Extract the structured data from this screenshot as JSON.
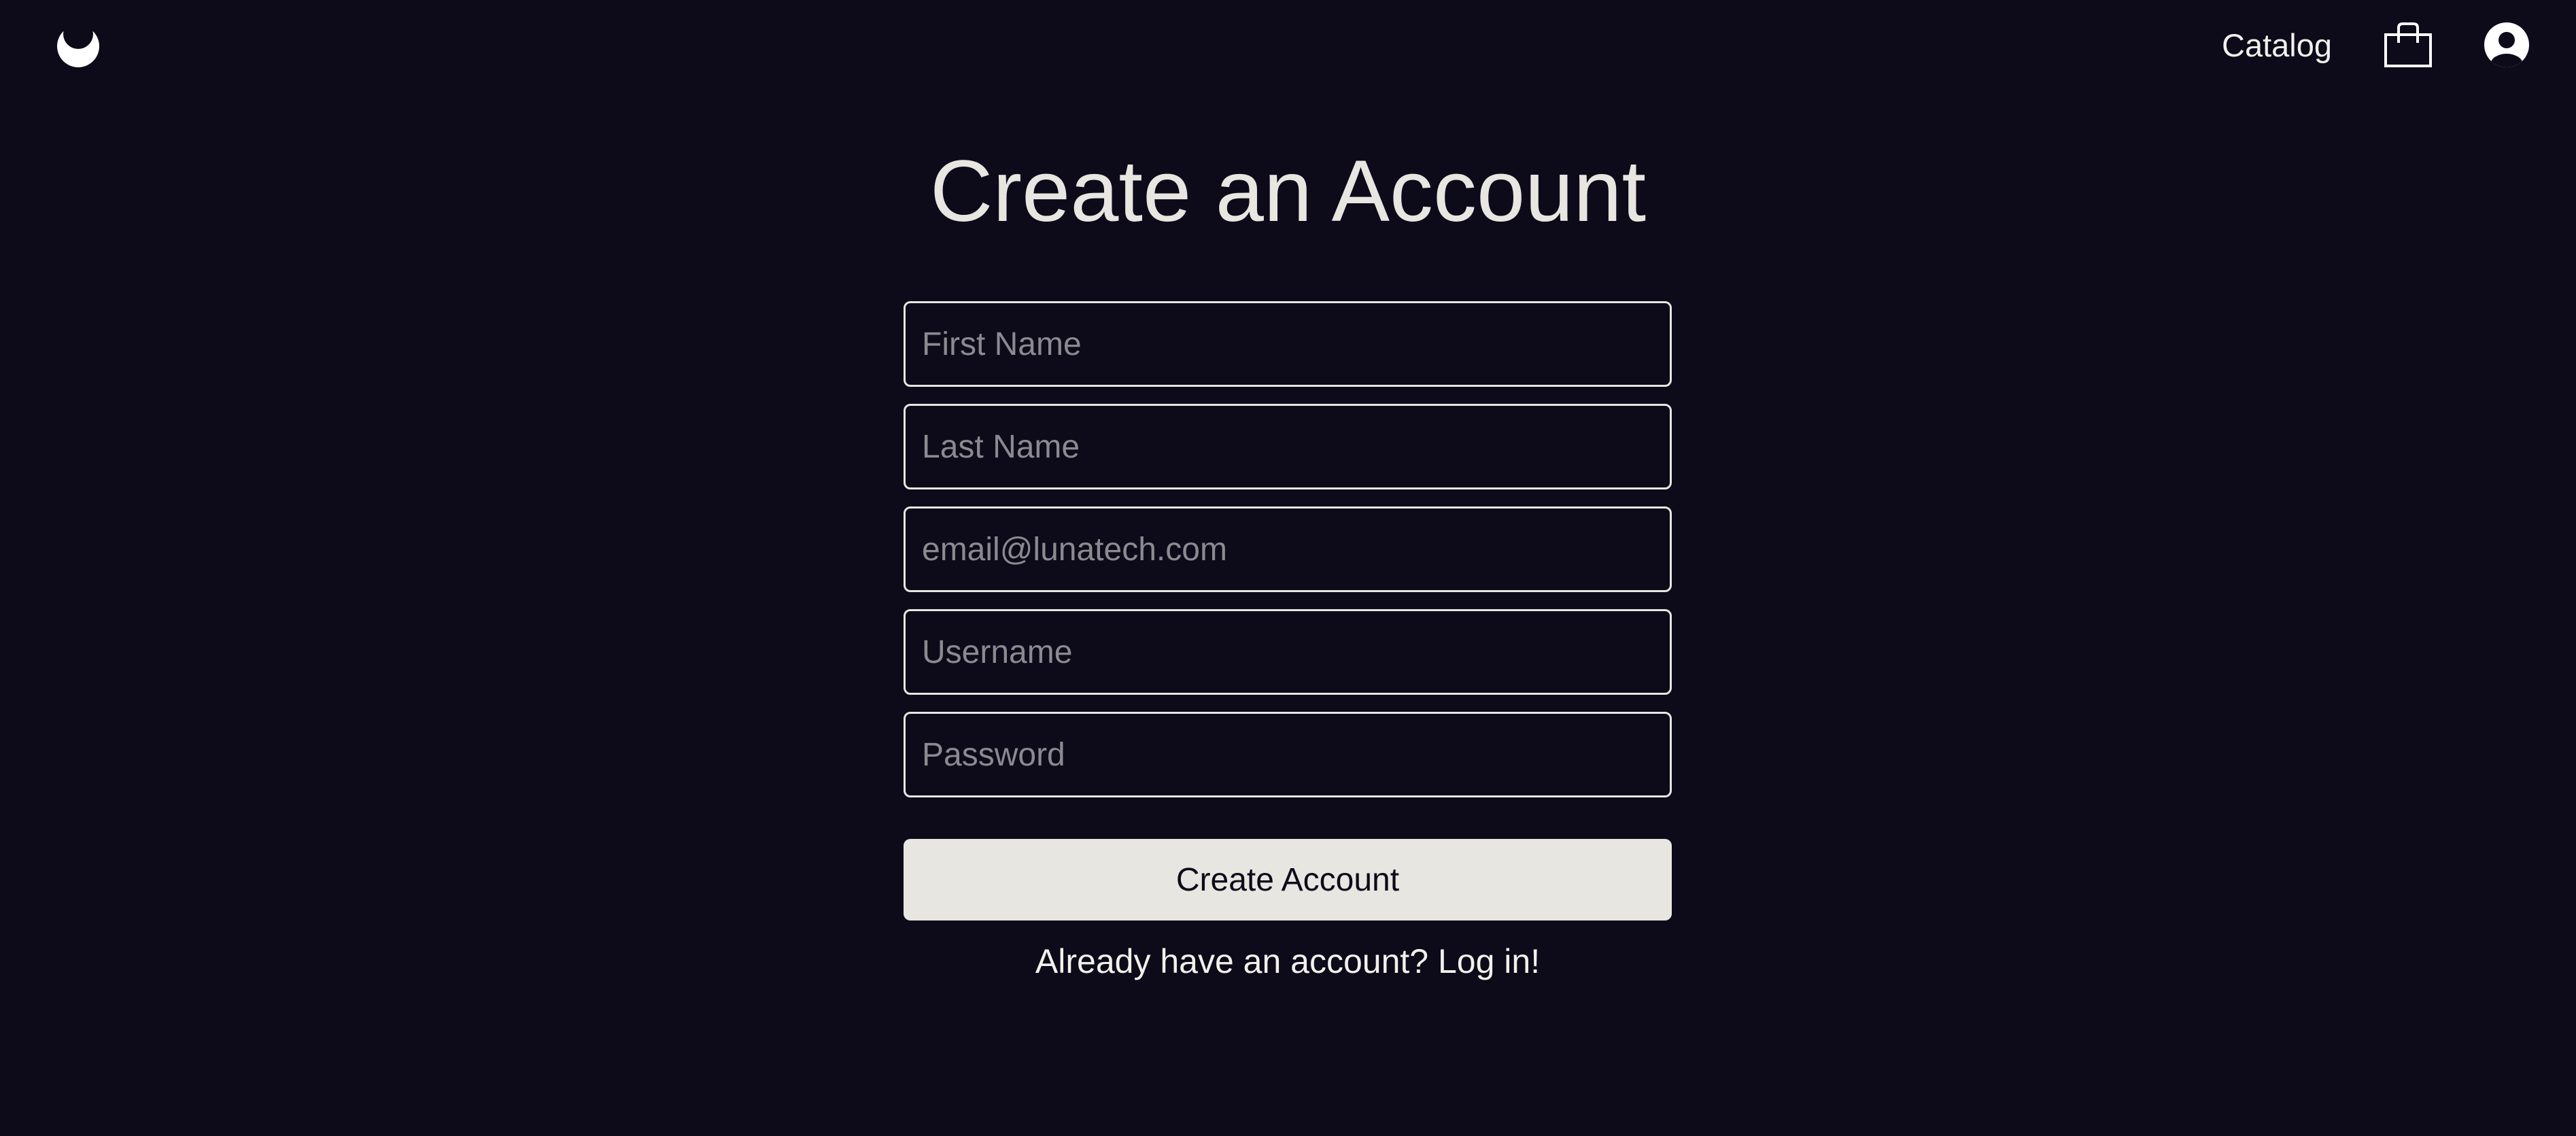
{
  "header": {
    "logo_icon": "crescent-moon-icon",
    "nav_catalog_label": "Catalog",
    "cart_icon": "shopping-bag-icon",
    "account_icon": "user-avatar-icon"
  },
  "main": {
    "title": "Create an Account",
    "fields": {
      "first_name": {
        "placeholder": "First Name",
        "value": ""
      },
      "last_name": {
        "placeholder": "Last Name",
        "value": ""
      },
      "email": {
        "placeholder": "email@lunatech.com",
        "value": ""
      },
      "username": {
        "placeholder": "Username",
        "value": ""
      },
      "password": {
        "placeholder": "Password",
        "value": ""
      }
    },
    "submit_label": "Create Account",
    "login_prompt": "Already have an account? Log in!"
  },
  "colors": {
    "background": "#0d0b1a",
    "foreground": "#e8e6e0",
    "placeholder": "#8c8a90",
    "button_bg": "#e8e6e0",
    "button_text": "#0d0b1a"
  }
}
